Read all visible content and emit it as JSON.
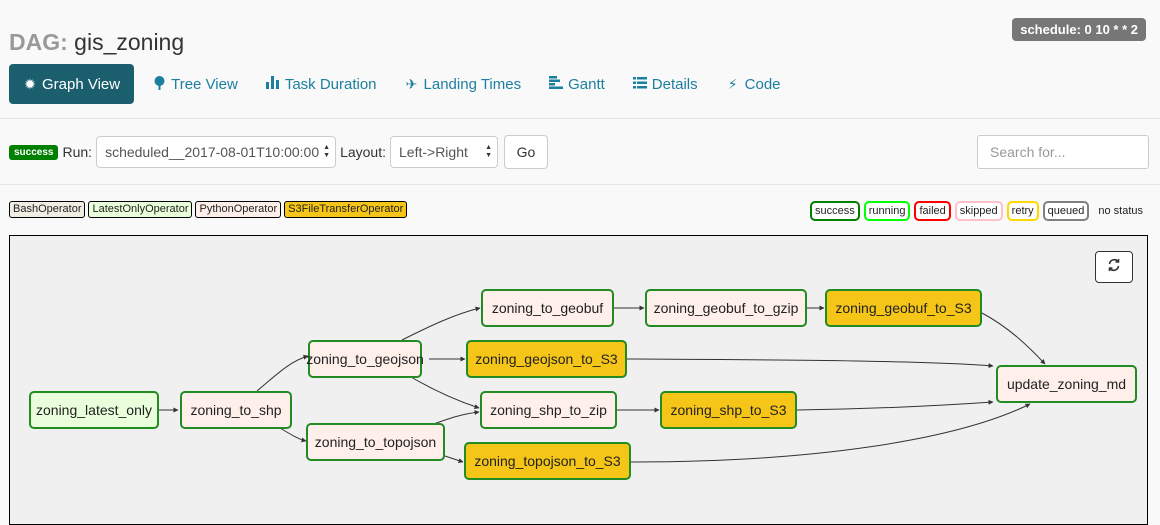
{
  "header": {
    "prefix": "DAG:",
    "dag_id": "gis_zoning",
    "schedule": "schedule: 0 10 * * 2"
  },
  "nav": {
    "tabs": [
      {
        "label": "Graph View",
        "icon": "asterisk-icon",
        "active": true
      },
      {
        "label": "Tree View",
        "icon": "tree-icon"
      },
      {
        "label": "Task Duration",
        "icon": "bar-chart-icon"
      },
      {
        "label": "Landing Times",
        "icon": "plane-icon"
      },
      {
        "label": "Gantt",
        "icon": "gantt-icon"
      },
      {
        "label": "Details",
        "icon": "list-icon"
      },
      {
        "label": "Code",
        "icon": "flash-icon"
      }
    ]
  },
  "controls": {
    "state": "success",
    "state_color": "#008000",
    "run_label": "Run:",
    "run_value": "scheduled__2017-08-01T10:00:00",
    "layout_label": "Layout:",
    "layout_value": "Left->Right",
    "go_label": "Go",
    "search_placeholder": "Search for..."
  },
  "operators": [
    {
      "label": "BashOperator",
      "color": "#f0ede4"
    },
    {
      "label": "LatestOnlyOperator",
      "color": "#e9ffdb"
    },
    {
      "label": "PythonOperator",
      "color": "#ffefeb"
    },
    {
      "label": "S3FileTransferOperator",
      "color": "#f5c518"
    }
  ],
  "states": [
    {
      "label": "success",
      "color": "#008000"
    },
    {
      "label": "running",
      "color": "#00ff00"
    },
    {
      "label": "failed",
      "color": "#ff0000"
    },
    {
      "label": "skipped",
      "color": "#ffc0cb"
    },
    {
      "label": "retry",
      "color": "#ffd700"
    },
    {
      "label": "queued",
      "color": "#808080"
    }
  ],
  "no_status": "no status",
  "tasks": {
    "latest": "zoning_latest_only",
    "to_shp": "zoning_to_shp",
    "to_geojson": "zoning_to_geojson",
    "to_topojson": "zoning_to_topojson",
    "to_geobuf": "zoning_to_geobuf",
    "geojson_s3": "zoning_geojson_to_S3",
    "shp_zip": "zoning_shp_to_zip",
    "topojson_s3": "zoning_topojson_to_S3",
    "geobuf_gzip": "zoning_geobuf_to_gzip",
    "shp_s3": "zoning_shp_to_S3",
    "geobuf_s3": "zoning_geobuf_to_S3",
    "update_md": "update_zoning_md"
  },
  "colors": {
    "latest_only": "#e9ffdb",
    "python": "#ffefeb",
    "s3": "#f5c518",
    "success_border": "#228b22"
  }
}
